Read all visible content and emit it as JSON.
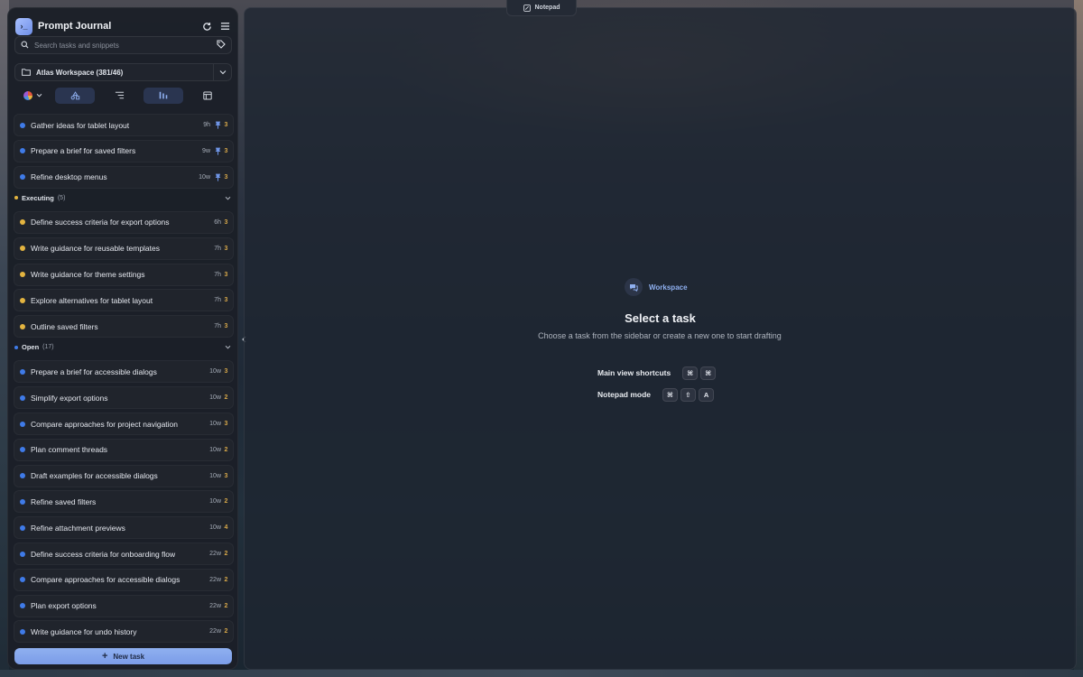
{
  "app": {
    "title": "Prompt Journal",
    "logo_glyph": "›_"
  },
  "search": {
    "placeholder": "Search tasks and snippets"
  },
  "workspace": {
    "label": "Atlas Workspace (381/46)"
  },
  "top_tasks": [
    {
      "title": "Gather ideas for tablet layout",
      "age": "9h",
      "count": "3",
      "pinned": true
    },
    {
      "title": "Prepare a brief for saved filters",
      "age": "9w",
      "count": "3",
      "pinned": true
    },
    {
      "title": "Refine desktop menus",
      "age": "10w",
      "count": "3",
      "pinned": true
    }
  ],
  "groups": {
    "executing": {
      "name": "Executing",
      "count": "(5)",
      "color": "#e3b440"
    },
    "open": {
      "name": "Open",
      "count": "(17)",
      "color": "#3f7be8"
    }
  },
  "executing_tasks": [
    {
      "title": "Define success criteria for export options",
      "age": "6h",
      "count": "3"
    },
    {
      "title": "Write guidance for reusable templates",
      "age": "7h",
      "count": "3"
    },
    {
      "title": "Write guidance for theme settings",
      "age": "7h",
      "count": "3"
    },
    {
      "title": "Explore alternatives for tablet layout",
      "age": "7h",
      "count": "3"
    },
    {
      "title": "Outline saved filters",
      "age": "7h",
      "count": "3"
    }
  ],
  "open_tasks": [
    {
      "title": "Prepare a brief for accessible dialogs",
      "age": "10w",
      "count": "3"
    },
    {
      "title": "Simplify export options",
      "age": "10w",
      "count": "2"
    },
    {
      "title": "Compare approaches for project navigation",
      "age": "10w",
      "count": "3"
    },
    {
      "title": "Plan comment threads",
      "age": "10w",
      "count": "2"
    },
    {
      "title": "Draft examples for accessible dialogs",
      "age": "10w",
      "count": "3"
    },
    {
      "title": "Refine saved filters",
      "age": "10w",
      "count": "2"
    },
    {
      "title": "Refine attachment previews",
      "age": "10w",
      "count": "4"
    },
    {
      "title": "Define success criteria for onboarding flow",
      "age": "22w",
      "count": "2"
    },
    {
      "title": "Compare approaches for accessible dialogs",
      "age": "22w",
      "count": "2"
    },
    {
      "title": "Plan export options",
      "age": "22w",
      "count": "2"
    },
    {
      "title": "Write guidance for undo history",
      "age": "22w",
      "count": "2"
    }
  ],
  "new_task": {
    "label": "New task",
    "plus": "+"
  },
  "notepad_tab": {
    "label": "Notepad"
  },
  "empty_state": {
    "badge": "Workspace",
    "title": "Select a task",
    "subtitle": "Choose a task from the sidebar or create a new one to start drafting",
    "shortcuts": [
      {
        "label": "Main view shortcuts",
        "keys": [
          "⌘",
          "⌘"
        ]
      },
      {
        "label": "Notepad mode",
        "keys": [
          "⌘",
          "⇧",
          "A"
        ]
      }
    ]
  },
  "colors": {
    "accent": "#8fb0f0",
    "status_open": "#3f7be8",
    "status_executing": "#e3b440",
    "count": "#d7a84a"
  }
}
